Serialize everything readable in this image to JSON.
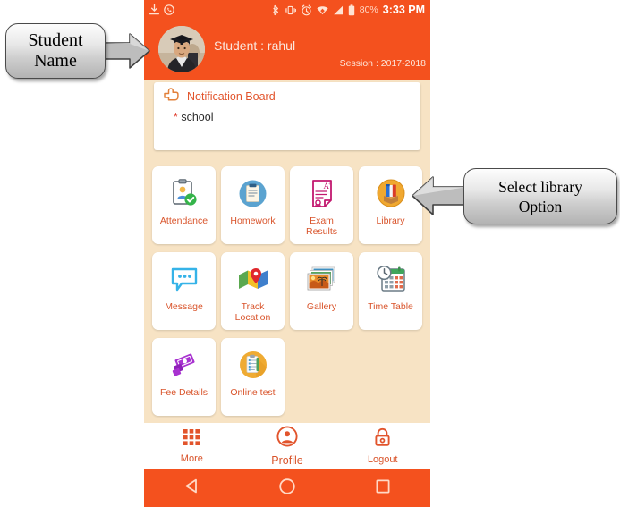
{
  "statusbar": {
    "icons_left": [
      "download-icon",
      "whatsapp-icon"
    ],
    "icons_right": [
      "bluetooth-icon",
      "vibrate-icon",
      "alarm-icon",
      "wifi-icon",
      "signal-icon",
      "battery-icon"
    ],
    "battery_percent": "80%",
    "clock": "3:33 PM"
  },
  "header": {
    "student_label": "Student : rahul",
    "session_label": "Session : 2017-2018",
    "avatar_name": "avatar"
  },
  "notification": {
    "title": "Notification Board",
    "items": [
      "school"
    ],
    "bullet": "*"
  },
  "grid": {
    "rows": [
      [
        {
          "label": "Attendance",
          "icon": "attendance-clipboard-icon"
        },
        {
          "label": "Homework",
          "icon": "homework-clipboard-icon"
        },
        {
          "label": "Exam Results",
          "icon": "exam-results-document-icon"
        },
        {
          "label": "Library",
          "icon": "library-books-icon"
        }
      ],
      [
        {
          "label": "Message",
          "icon": "message-bubble-icon"
        },
        {
          "label": "Track Location",
          "icon": "track-location-map-icon"
        },
        {
          "label": "Gallery",
          "icon": "gallery-photos-icon"
        },
        {
          "label": "Time Table",
          "icon": "time-table-calendar-clock-icon"
        }
      ],
      [
        {
          "label": "Fee Details",
          "icon": "fee-details-money-icon"
        },
        {
          "label": "Online test",
          "icon": "online-test-clipboard-icon"
        }
      ]
    ]
  },
  "bottomnav": {
    "items": [
      {
        "label": "More",
        "icon": "grid-dots-icon"
      },
      {
        "label": "Profile",
        "icon": "person-circle-icon"
      },
      {
        "label": "Logout",
        "icon": "padlock-icon"
      }
    ]
  },
  "androidnav": {
    "back": "back-triangle-icon",
    "home": "home-circle-icon",
    "recents": "recents-square-icon"
  },
  "callouts": [
    {
      "text": "Student Name",
      "line1": "Student",
      "line2": "Name",
      "direction": "right"
    },
    {
      "text": "Select library Option",
      "line1": "Select library",
      "line2": "Option",
      "direction": "left"
    }
  ],
  "colors": {
    "brand_orange": "#F4511E",
    "screen_background": "#F7E3C4",
    "tile_label": "#D9542B",
    "card_white": "#FFFFFF"
  }
}
